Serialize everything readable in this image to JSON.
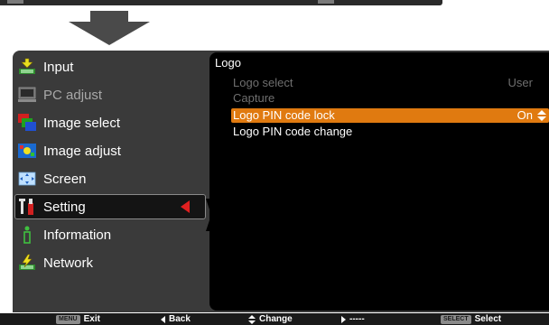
{
  "sidebar": {
    "items": [
      {
        "label": "Input",
        "icon": "input-icon"
      },
      {
        "label": "PC adjust",
        "icon": "pc-adjust-icon"
      },
      {
        "label": "Image select",
        "icon": "image-select-icon"
      },
      {
        "label": "Image adjust",
        "icon": "image-adjust-icon"
      },
      {
        "label": "Screen",
        "icon": "screen-icon"
      },
      {
        "label": "Setting",
        "icon": "setting-icon"
      },
      {
        "label": "Information",
        "icon": "information-icon"
      },
      {
        "label": "Network",
        "icon": "network-icon"
      }
    ]
  },
  "content": {
    "title": "Logo",
    "options": [
      {
        "label": "Logo select",
        "value": "User"
      },
      {
        "label": "Capture",
        "value": ""
      },
      {
        "label": "Logo PIN code lock",
        "value": "On"
      },
      {
        "label": "Logo PIN code change",
        "value": ""
      }
    ]
  },
  "statusbar": {
    "exit_key": "MENU",
    "exit_label": "Exit",
    "back_label": "Back",
    "change_label": "Change",
    "next_label": "-----",
    "select_key": "SELECT",
    "select_label": "Select"
  },
  "colors": {
    "highlight": "#e07a10",
    "panel": "#3a3a3a",
    "content_bg": "#000000",
    "pointer": "#e02020"
  }
}
